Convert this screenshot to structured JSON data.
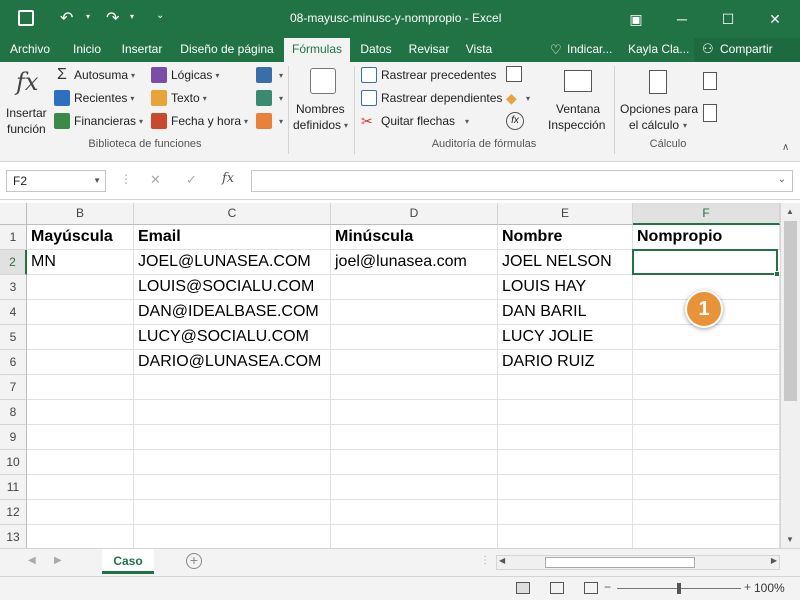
{
  "window": {
    "title": "08-mayusc-minusc-y-nompropio  -  Excel",
    "save_icon": "save-icon",
    "undo_icon": "undo-icon",
    "redo_icon": "redo-icon"
  },
  "tabs": [
    "Archivo",
    "Inicio",
    "Insertar",
    "Diseño de página",
    "Fórmulas",
    "Datos",
    "Revisar",
    "Vista"
  ],
  "active_tab": "Fórmulas",
  "tellme": "Indicar...",
  "user": "Kayla Cla...",
  "share": "Compartir",
  "ribbon": {
    "insert_function": [
      "Insertar",
      "función"
    ],
    "autosum": "Autosuma",
    "recent": "Recientes",
    "financial": "Financieras",
    "logical": "Lógicas",
    "text": "Texto",
    "datetime": "Fecha y hora",
    "names": [
      "Nombres",
      "definidos"
    ],
    "trace_prec": "Rastrear precedentes",
    "trace_dep": "Rastrear dependientes",
    "remove_arrows": "Quitar flechas",
    "watch": [
      "Ventana",
      "Inspección"
    ],
    "calc_options": [
      "Opciones para",
      "el cálculo"
    ],
    "group_library": "Biblioteca de funciones",
    "group_audit": "Auditoría de fórmulas",
    "group_calc": "Cálculo"
  },
  "namebox": "F2",
  "fx_label": "fx",
  "formula": "",
  "columns": [
    "B",
    "C",
    "D",
    "E",
    "F"
  ],
  "rows": [
    "1",
    "2",
    "3",
    "4",
    "5",
    "6",
    "7",
    "8",
    "9",
    "10",
    "11",
    "12",
    "13"
  ],
  "cells": [
    [
      "Mayúscula",
      "Email",
      "Minúscula",
      "Nombre",
      "Nompropio"
    ],
    [
      "MN",
      "JOEL@LUNASEA.COM",
      "joel@lunasea.com",
      "JOEL NELSON",
      ""
    ],
    [
      "",
      "LOUIS@SOCIALU.COM",
      "",
      "LOUIS HAY",
      ""
    ],
    [
      "",
      "DAN@IDEALBASE.COM",
      "",
      "DAN BARIL",
      ""
    ],
    [
      "",
      "LUCY@SOCIALU.COM",
      "",
      "LUCY JOLIE",
      ""
    ],
    [
      "",
      "DARIO@LUNASEA.COM",
      "",
      "DARIO RUIZ",
      ""
    ]
  ],
  "callout": "1",
  "sheet_tab": "Caso",
  "zoom": "100%",
  "accent": "#217346"
}
